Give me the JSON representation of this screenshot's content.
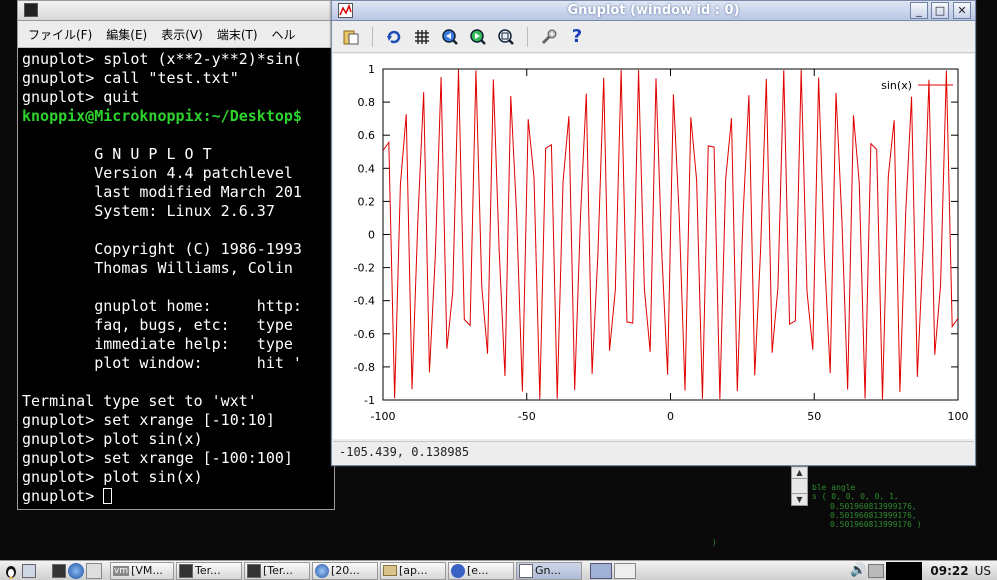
{
  "terminal": {
    "menus": [
      "ファイル(F)",
      "編集(E)",
      "表示(V)",
      "端末(T)",
      "ヘル"
    ],
    "lines": [
      {
        "text": "gnuplot> splot (x**2-y**2)*sin(",
        "green": false
      },
      {
        "text": "gnuplot> call \"test.txt\"",
        "green": false
      },
      {
        "text": "gnuplot> quit",
        "green": false
      },
      {
        "text": "knoppix@Microknoppix:~/Desktop$",
        "green": true
      },
      {
        "text": "",
        "green": false
      },
      {
        "text": "        G N U P L O T",
        "green": false
      },
      {
        "text": "        Version 4.4 patchlevel",
        "green": false
      },
      {
        "text": "        last modified March 201",
        "green": false
      },
      {
        "text": "        System: Linux 2.6.37",
        "green": false
      },
      {
        "text": "",
        "green": false
      },
      {
        "text": "        Copyright (C) 1986-1993",
        "green": false
      },
      {
        "text": "        Thomas Williams, Colin",
        "green": false
      },
      {
        "text": "",
        "green": false
      },
      {
        "text": "        gnuplot home:     http:",
        "green": false
      },
      {
        "text": "        faq, bugs, etc:   type",
        "green": false
      },
      {
        "text": "        immediate help:   type",
        "green": false
      },
      {
        "text": "        plot window:      hit '",
        "green": false
      },
      {
        "text": "",
        "green": false
      },
      {
        "text": "Terminal type set to 'wxt'",
        "green": false
      },
      {
        "text": "gnuplot> set xrange [-10:10]",
        "green": false
      },
      {
        "text": "gnuplot> plot sin(x)",
        "green": false
      },
      {
        "text": "gnuplot> set xrange [-100:100]",
        "green": false
      },
      {
        "text": "gnuplot> plot sin(x)",
        "green": false
      }
    ],
    "prompt": "gnuplot> "
  },
  "gnuplot_window": {
    "title": "Gnuplot (window id : 0)",
    "toolbar_icons": [
      "copy-clipboard-icon",
      "replot-icon",
      "grid-icon",
      "zoom-previous-icon",
      "zoom-next-icon",
      "autoscale-icon",
      "config-icon",
      "help-icon"
    ],
    "status": "-105.439,  0.138985",
    "controls": {
      "minimize": "_",
      "maximize": "□",
      "close": "✕"
    }
  },
  "chart_data": {
    "type": "line",
    "function": "sin(x)",
    "series": [
      {
        "name": "sin(x)",
        "color": "#e00000"
      }
    ],
    "xlim": [
      -100,
      100
    ],
    "ylim": [
      -1,
      1
    ],
    "samples": 100,
    "x_ticks": [
      "-100",
      "-50",
      "0",
      "50",
      "100"
    ],
    "y_ticks": [
      "1",
      "0.8",
      "0.6",
      "0.4",
      "0.2",
      "0",
      "-0.2",
      "-0.4",
      "-0.6",
      "-0.8",
      "-1"
    ],
    "legend_position": "top-right"
  },
  "desktop_text": [
    "ble angle",
    "s ( 0, 0, 0, 0, 1,",
    "0.501960813999176,",
    "0.501960813999176,",
    "0.501960813999176 )",
    ")"
  ],
  "taskbar": {
    "items": [
      "[VM...",
      "Ter...",
      "[Ter...",
      "[20...",
      "[ap...",
      "[e...",
      "Gn..."
    ],
    "clock": "09:22",
    "layout": "US"
  }
}
